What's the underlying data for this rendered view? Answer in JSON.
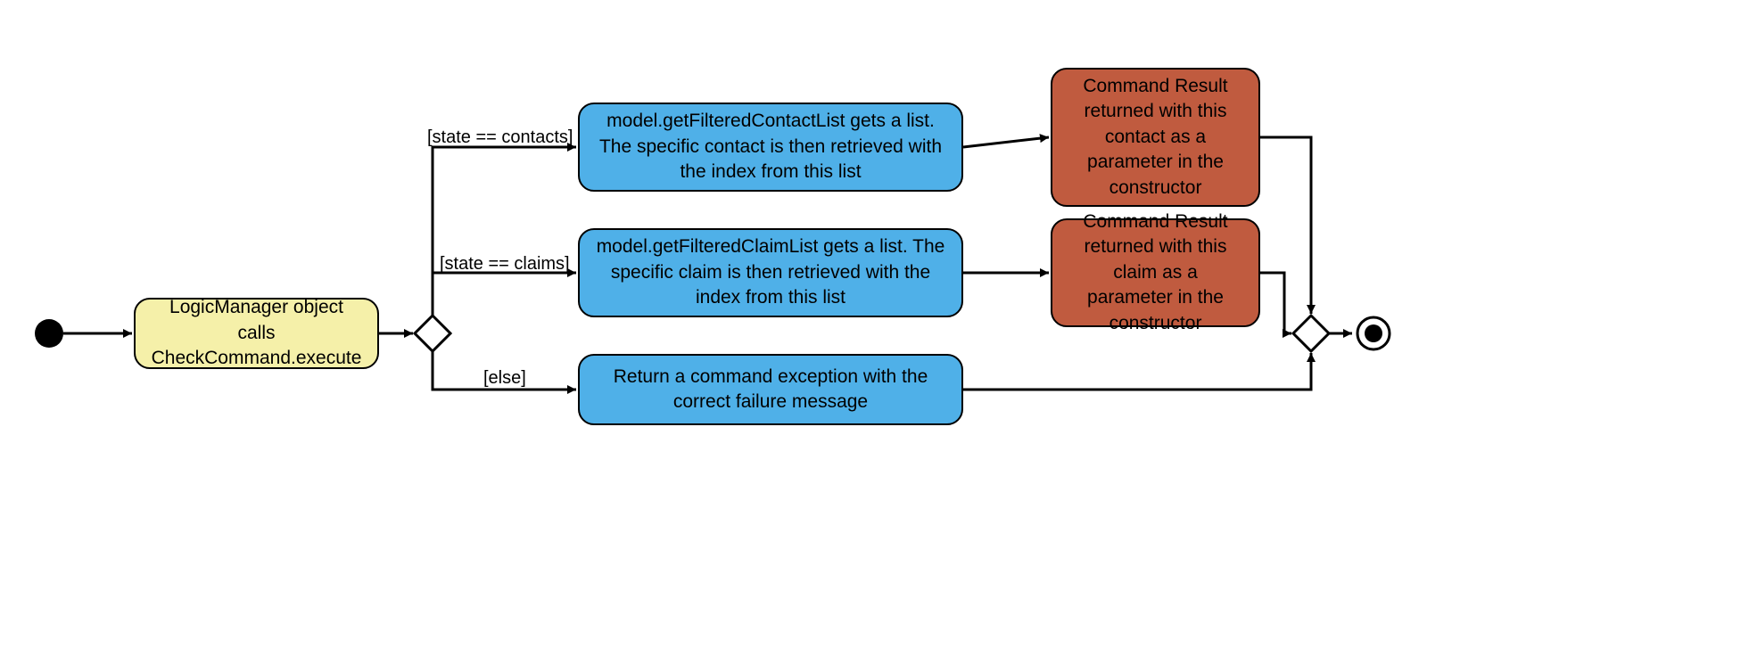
{
  "chart_data": {
    "type": "activity-diagram",
    "nodes": [
      {
        "id": "start",
        "kind": "initial"
      },
      {
        "id": "logic",
        "kind": "action",
        "color": "yellow",
        "text": "LogicManager object calls CheckCommand.execute"
      },
      {
        "id": "decision1",
        "kind": "decision"
      },
      {
        "id": "contactAction",
        "kind": "action",
        "color": "blue",
        "text": "model.getFilteredContactList gets a list. The specific contact is then retrieved with the index from this list"
      },
      {
        "id": "claimAction",
        "kind": "action",
        "color": "blue",
        "text": "model.getFilteredClaimList gets a list. The specific claim is then retrieved with the index from this list"
      },
      {
        "id": "elseAction",
        "kind": "action",
        "color": "blue",
        "text": "Return a command exception with the correct failure message"
      },
      {
        "id": "contactResult",
        "kind": "action",
        "color": "red",
        "text": "Command Result returned with this contact as a parameter in the constructor"
      },
      {
        "id": "claimResult",
        "kind": "action",
        "color": "red",
        "text": "Command Result returned with this claim as a parameter in the constructor"
      },
      {
        "id": "merge",
        "kind": "merge"
      },
      {
        "id": "end",
        "kind": "final"
      }
    ],
    "edges": [
      {
        "from": "start",
        "to": "logic"
      },
      {
        "from": "logic",
        "to": "decision1"
      },
      {
        "from": "decision1",
        "to": "contactAction",
        "guard": "[state == contacts]"
      },
      {
        "from": "decision1",
        "to": "claimAction",
        "guard": "[state == claims]"
      },
      {
        "from": "decision1",
        "to": "elseAction",
        "guard": "[else]"
      },
      {
        "from": "contactAction",
        "to": "contactResult"
      },
      {
        "from": "claimAction",
        "to": "claimResult"
      },
      {
        "from": "contactResult",
        "to": "merge"
      },
      {
        "from": "claimResult",
        "to": "merge"
      },
      {
        "from": "elseAction",
        "to": "merge"
      },
      {
        "from": "merge",
        "to": "end"
      }
    ],
    "guards": {
      "contacts": "[state == contacts]",
      "claims": "[state == claims]",
      "else": "[else]"
    }
  },
  "colors": {
    "yellow": "#f5f0a9",
    "blue": "#4fb0e8",
    "red": "#c05b3f"
  }
}
